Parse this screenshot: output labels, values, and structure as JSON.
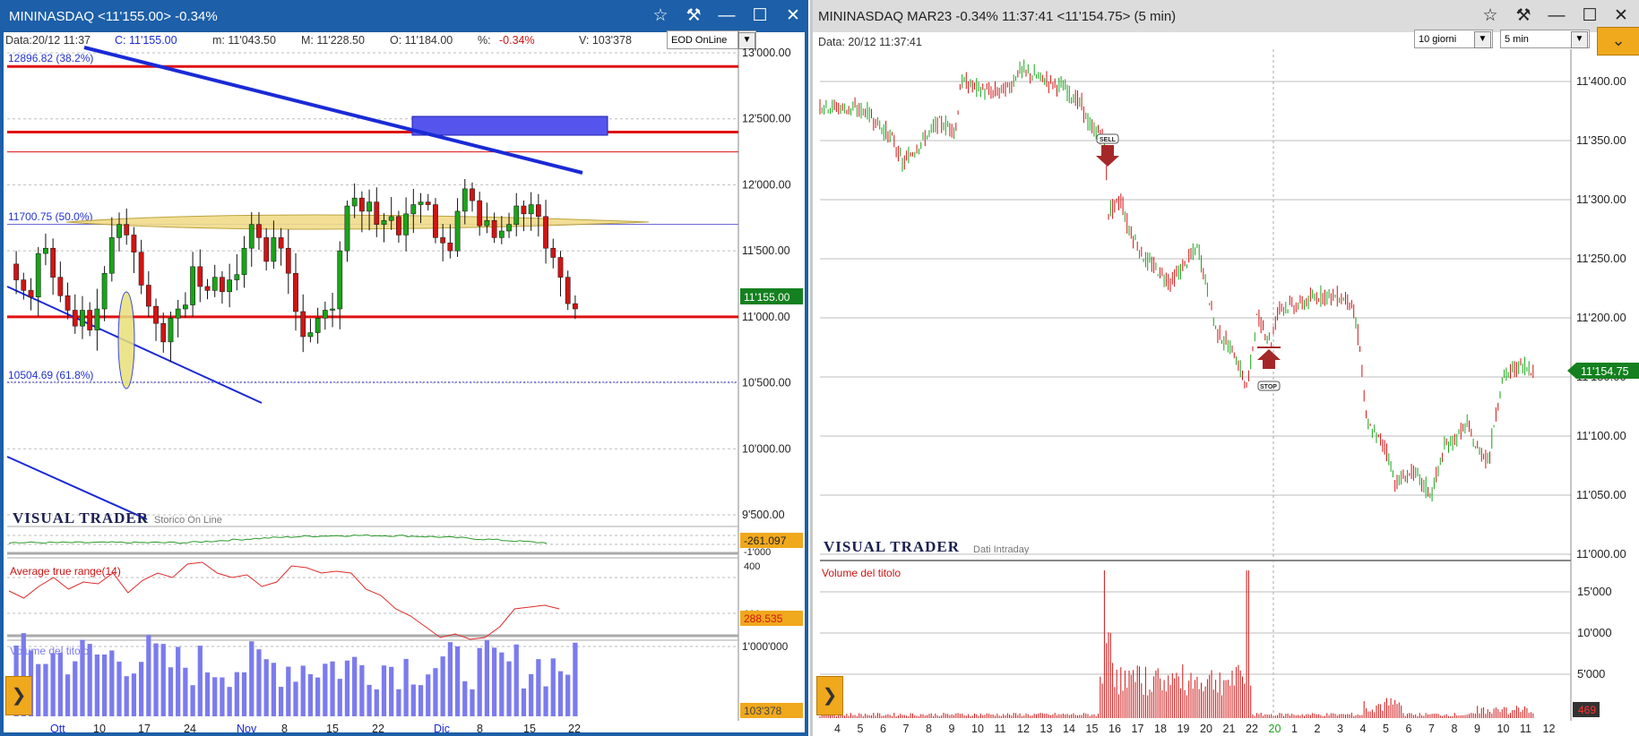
{
  "left": {
    "title": "MININASDAQ <11'155.00>  -0.34%",
    "info": {
      "date": "Data:20/12 11:37",
      "close": "C: 11'155.00",
      "min": "m: 11'043.50",
      "max": "M: 11'228.50",
      "open": "O: 11'184.00",
      "pct_label": "%:",
      "pct": "-0.34%",
      "vol": "V: 103'378"
    },
    "mode_button": "EOD OnLine",
    "fib_top": "12896.82 (38.2%)",
    "fib_mid": "11700.75 (50.0%)",
    "fib_bot": "10504.69 (61.8%)",
    "y_ticks": [
      "13'000.00",
      "12'500.00",
      "12'000.00",
      "11'500.00",
      "11'000.00",
      "10'500.00",
      "10'000.00",
      "9'500.00"
    ],
    "last_price": "11'155.00",
    "brand": "VISUAL TRADER",
    "brand_sub": "Storico On Line",
    "osc_value": "-261.097",
    "osc_tick": "-1'000",
    "atr_label": "Average true range(14)",
    "atr_tick": "400",
    "atr_tick2": "200",
    "atr_value": "288.535",
    "vol_label": "Volume del titolo",
    "vol_tick": "1'000'000",
    "vol_value": "103'378",
    "x_labels": [
      "Ott",
      "10",
      "17",
      "24",
      "Nov",
      "8",
      "15",
      "22",
      "Dic",
      "8",
      "15",
      "22"
    ],
    "colors": {
      "up": "#1aa31a",
      "down": "#d01414",
      "trend": "#1a2ad6",
      "level": "#e01010",
      "accent": "#f0a81c"
    }
  },
  "right": {
    "title": "MININASDAQ MAR23  -0.34%  11:37:41   <11'154.75>  (5 min)",
    "date": "Data: 20/12 11:37:41",
    "period_select": "10 giorni",
    "tf_select": "5 min",
    "y_ticks": [
      "11'400.00",
      "11'350.00",
      "11'300.00",
      "11'250.00",
      "11'200.00",
      "11'150.00",
      "11'100.00",
      "11'050.00",
      "11'000.00"
    ],
    "last_price": "11'154.75",
    "sell_label": "SELL",
    "stop_label": "STOP",
    "brand": "VISUAL TRADER",
    "brand_sub": "Dati Intraday",
    "vol_label": "Volume del titolo",
    "vol_ticks": [
      "15'000",
      "10'000",
      "5'000"
    ],
    "vol_value": "469",
    "x_labels": [
      "4",
      "5",
      "6",
      "7",
      "8",
      "9",
      "10",
      "11",
      "12",
      "13",
      "14",
      "15",
      "16",
      "17",
      "18",
      "19",
      "20",
      "21",
      "22",
      "20",
      "1",
      "2",
      "3",
      "4",
      "5",
      "6",
      "7",
      "8",
      "9",
      "10",
      "11",
      "12"
    ]
  },
  "icons": [
    "star-icon",
    "pin-icon",
    "minimize-icon",
    "maximize-icon",
    "close-icon",
    "chevron-down-icon",
    "chevron-right-icon"
  ]
}
